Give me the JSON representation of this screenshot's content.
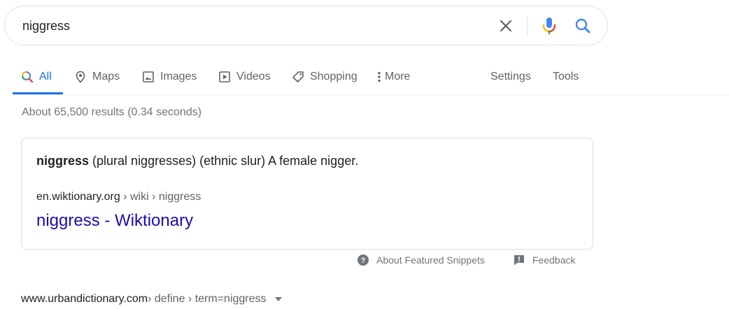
{
  "search": {
    "query": "niggress",
    "icons": [
      "close-icon",
      "microphone-icon",
      "search-icon"
    ]
  },
  "tabs": [
    {
      "label": "All",
      "icon": "search-icon",
      "active": true
    },
    {
      "label": "Maps",
      "icon": "map-pin-icon"
    },
    {
      "label": "Images",
      "icon": "image-icon"
    },
    {
      "label": "Videos",
      "icon": "video-icon"
    },
    {
      "label": "Shopping",
      "icon": "tag-icon"
    },
    {
      "label": "More",
      "icon": "more-vertical-icon"
    }
  ],
  "tools": {
    "settings": "Settings",
    "tools": "Tools"
  },
  "stats": "About 65,500 results (0.34 seconds)",
  "snippet": {
    "term": "niggress",
    "definition": " (plural niggresses) (ethnic slur) A female nigger.",
    "cite_domain": "en.wiktionary.org",
    "cite_path": " › wiki › niggress",
    "title": "niggress - Wiktionary"
  },
  "snippet_footer": {
    "about": "About Featured Snippets",
    "feedback": "Feedback"
  },
  "second_result": {
    "cite_domain": "www.urbandictionary.com",
    "cite_path": " › define › term=niggress"
  },
  "colors": {
    "link": "#1a0dab",
    "accent": "#1a73e8",
    "muted": "#70757a"
  }
}
